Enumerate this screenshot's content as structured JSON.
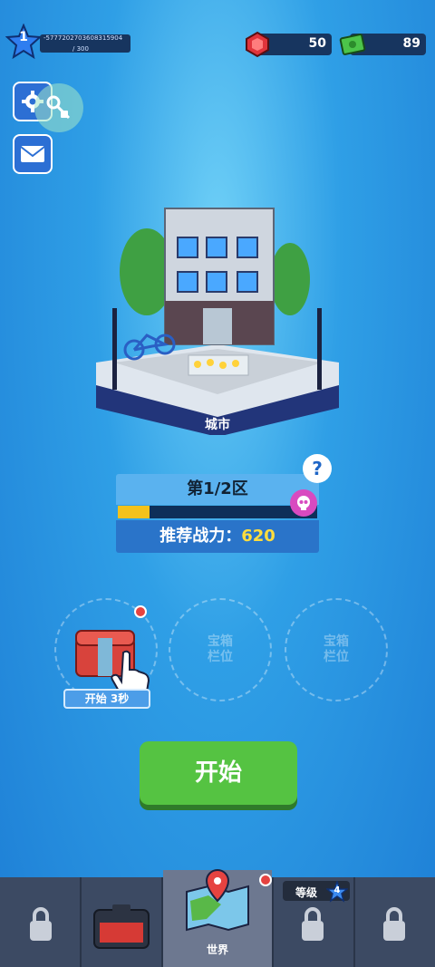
{
  "player": {
    "level": "1",
    "xp_text": "-5777202703608315904",
    "xp_max": "/ 300"
  },
  "resources": {
    "gems": "50",
    "cash": "89"
  },
  "map": {
    "location_name": "城市"
  },
  "region": {
    "title": "第1/2区",
    "progress_fraction": 0.16,
    "power_label": "推荐战力：",
    "power_value": "620",
    "help_icon": "?"
  },
  "chest_slots": [
    {
      "label": "开始 3秒"
    },
    {
      "label_line1": "宝箱",
      "label_line2": "栏位"
    },
    {
      "label_line1": "宝箱",
      "label_line2": "栏位"
    }
  ],
  "start_button": "开始",
  "bottom_nav": {
    "world_label": "世界",
    "rank_label": "等级",
    "rank_value": "4"
  },
  "colors": {
    "accent_green": "#55c342",
    "progress_yellow": "#f3c21c",
    "nav_bg": "#3c4a63"
  },
  "icons": [
    "star-icon",
    "gem-icon",
    "cash-icon",
    "gear-icon",
    "key-icon",
    "mail-icon",
    "lock-icon",
    "skull-icon",
    "chest-icon",
    "map-pin-icon",
    "pointer-hand-icon"
  ]
}
